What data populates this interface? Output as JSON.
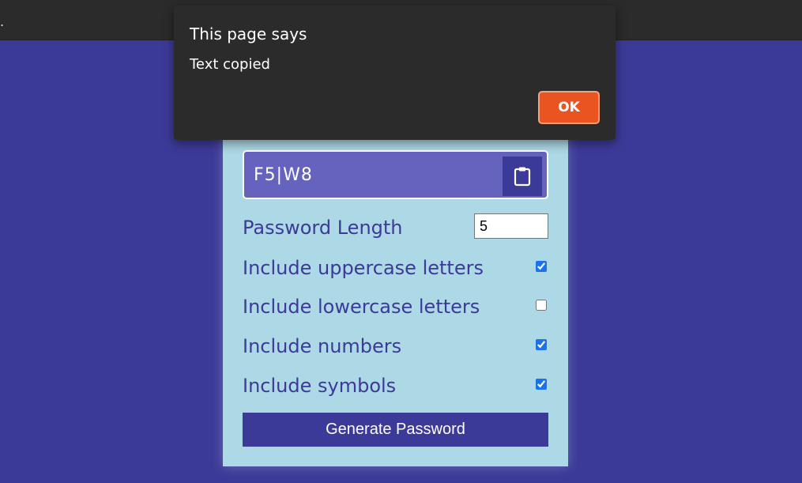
{
  "browser": {
    "corner_text": "."
  },
  "dialog": {
    "title": "This page says",
    "message": "Text copied",
    "ok_label": "OK"
  },
  "generator": {
    "result": "F5|W8",
    "clipboard_icon": "clipboard-icon",
    "length_label": "Password Length",
    "length_value": "5",
    "options": [
      {
        "label": "Include uppercase letters",
        "checked": true
      },
      {
        "label": "Include lowercase letters",
        "checked": false
      },
      {
        "label": "Include numbers",
        "checked": true
      },
      {
        "label": "Include symbols",
        "checked": true
      }
    ],
    "generate_label": "Generate Password"
  },
  "colors": {
    "background": "#3c3a98",
    "card": "#add8e6",
    "result_box": "#6563bd",
    "accent_orange": "#e95420",
    "dialog": "#2b2b2b"
  }
}
